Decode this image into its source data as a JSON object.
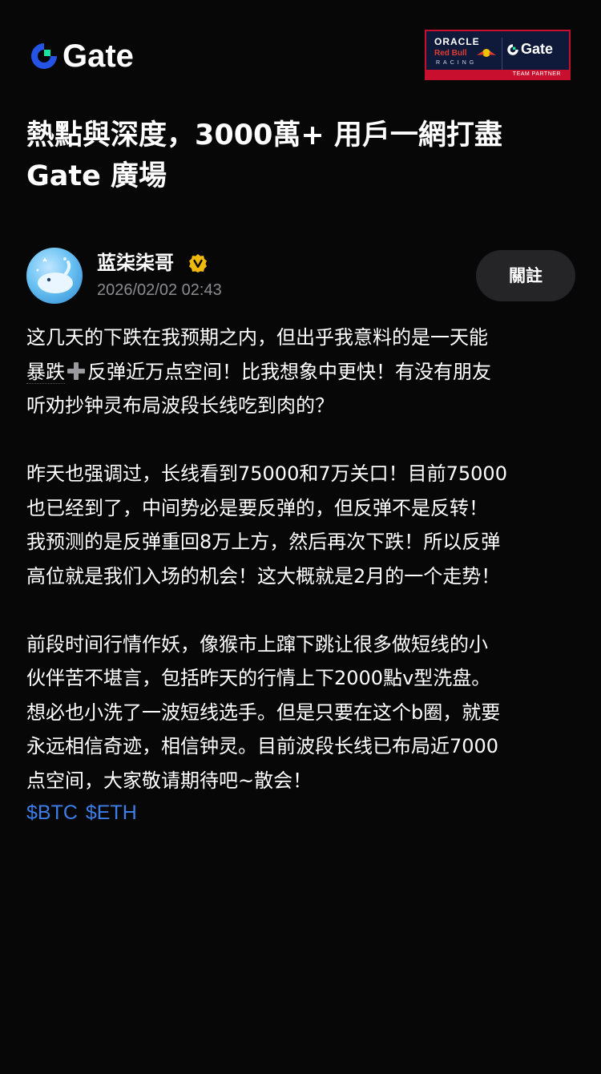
{
  "header": {
    "brand": "Gate",
    "partner": {
      "oracle": "ORACLE",
      "redbull": "Red Bull",
      "racing": "RACING",
      "brand": "Gate",
      "badge": "TEAM PARTNER"
    }
  },
  "title": {
    "line1": "熱點與深度，3000萬+ 用戶一網打盡",
    "line2": "Gate 廣場"
  },
  "author": {
    "name": "蓝柒柒哥",
    "timestamp": "2026/02/02 02:43",
    "follow_label": "關註"
  },
  "post": {
    "p1_l1": "这几天的下跌在我预期之内，但出乎我意料的是一天能",
    "p1_l2a": "暴跌",
    "p1_l2b": "反弹近万点空间！比我想象中更快！有没有朋友",
    "p1_l3": "听劝抄钟灵布局波段长线吃到肉的？",
    "p2_l1": "昨天也强调过，长线看到75000和7万关口！目前75000",
    "p2_l2": "也已经到了，中间势必是要反弹的，但反弹不是反转！",
    "p2_l3": "我预测的是反弹重回8万上方，然后再次下跌！所以反弹",
    "p2_l4": "高位就是我们入场的机会！这大概就是2月的一个走势！",
    "p3_l1": "前段时间行情作妖，像猴市上蹿下跳让很多做短线的小",
    "p3_l2": "伙伴苦不堪言，包括昨天的行情上下2000點v型洗盘。",
    "p3_l3": "想必也小洗了一波短线选手。但是只要在这个b圈，就要",
    "p3_l4": "永远相信奇迹，相信钟灵。目前波段长线已布局近7000",
    "p3_l5": "点空间，大家敬请期待吧~散会！"
  },
  "tags": [
    "$BTC",
    "$ETH"
  ],
  "colors": {
    "background": "#070708",
    "brand_blue": "#2354e6",
    "brand_green": "#17e6a1",
    "tag_blue": "#3d7de8",
    "verified_gold": "#f0b90b",
    "button_bg": "#252528"
  }
}
